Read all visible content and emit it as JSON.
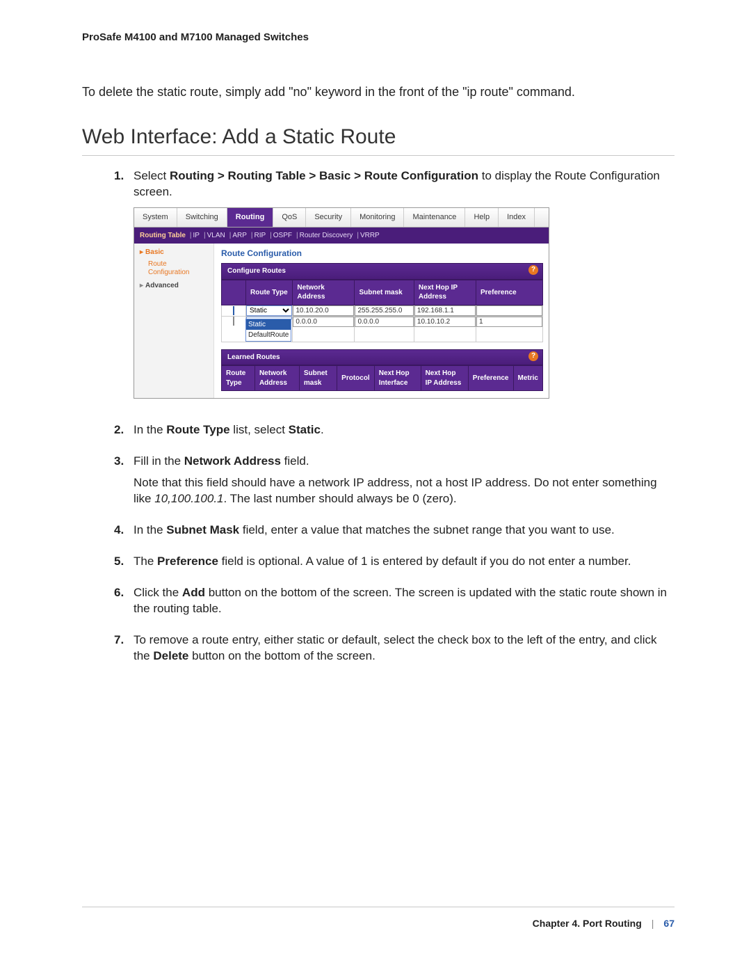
{
  "running_header": "ProSafe M4100 and M7100 Managed Switches",
  "intro": "To delete the static route, simply add \"no\" keyword in the front of the \"ip route\" command.",
  "heading": "Web Interface: Add a Static Route",
  "steps": [
    {
      "num": "1.",
      "html_parts": [
        {
          "t": "plain",
          "v": "Select "
        },
        {
          "t": "bold",
          "v": "Routing > Routing Table > Basic > Route Configuration"
        },
        {
          "t": "plain",
          "v": " to display the Route Configuration screen."
        }
      ]
    },
    {
      "num": "2.",
      "html_parts": [
        {
          "t": "plain",
          "v": "In the "
        },
        {
          "t": "bold",
          "v": "Route Type"
        },
        {
          "t": "plain",
          "v": " list, select "
        },
        {
          "t": "bold",
          "v": "Static"
        },
        {
          "t": "plain",
          "v": "."
        }
      ]
    },
    {
      "num": "3.",
      "html_parts": [
        {
          "t": "plain",
          "v": "Fill in the "
        },
        {
          "t": "bold",
          "v": "Network Address"
        },
        {
          "t": "plain",
          "v": " field."
        }
      ],
      "note_parts": [
        {
          "t": "plain",
          "v": "Note that this field should have a network IP address, not a host IP address. Do not enter something like "
        },
        {
          "t": "italic",
          "v": "10,100.100.1"
        },
        {
          "t": "plain",
          "v": ". The last number should always be 0 (zero)."
        }
      ]
    },
    {
      "num": "4.",
      "html_parts": [
        {
          "t": "plain",
          "v": "In the "
        },
        {
          "t": "bold",
          "v": "Subnet Mask"
        },
        {
          "t": "plain",
          "v": " field, enter a value that matches the subnet range that you want to use."
        }
      ]
    },
    {
      "num": "5.",
      "html_parts": [
        {
          "t": "plain",
          "v": "The "
        },
        {
          "t": "bold",
          "v": "Preference"
        },
        {
          "t": "plain",
          "v": " field is optional. A value of 1 is entered by default if you do not enter a number."
        }
      ]
    },
    {
      "num": "6.",
      "html_parts": [
        {
          "t": "plain",
          "v": "Click the "
        },
        {
          "t": "bold",
          "v": "Add"
        },
        {
          "t": "plain",
          "v": " button on the bottom of the screen. The screen is updated with the static route shown in the routing table."
        }
      ]
    },
    {
      "num": "7.",
      "html_parts": [
        {
          "t": "plain",
          "v": "To remove a route entry, either static or default, select the check box to the left of the entry, and click the "
        },
        {
          "t": "bold",
          "v": "Delete"
        },
        {
          "t": "plain",
          "v": " button on the bottom of the screen."
        }
      ]
    }
  ],
  "ui": {
    "top_tabs": [
      "System",
      "Switching",
      "Routing",
      "QoS",
      "Security",
      "Monitoring",
      "Maintenance",
      "Help",
      "Index"
    ],
    "active_top": "Routing",
    "sub_tabs": [
      "Routing Table",
      "IP",
      "VLAN",
      "ARP",
      "RIP",
      "OSPF",
      "Router Discovery",
      "VRRP"
    ],
    "active_sub": "Routing Table",
    "sidebar": {
      "section": "Basic",
      "sub_item": "Route Configuration",
      "other": "Advanced"
    },
    "panel_title": "Route Configuration",
    "configure_bar": "Configure Routes",
    "headers1": [
      "Route Type",
      "Network Address",
      "Subnet mask",
      "Next Hop IP Address",
      "Preference"
    ],
    "rows1": [
      {
        "checked": true,
        "type_select": "Static",
        "net": "10.10.20.0",
        "mask": "255.255.255.0",
        "hop": "192.168.1.1",
        "pref": ""
      },
      {
        "checked": false,
        "type_display": "Static",
        "dropdown_options": [
          "Static",
          "DefaultRoute"
        ],
        "net": "0.0.0.0",
        "mask": "0.0.0.0",
        "hop": "10.10.10.2",
        "pref": "1"
      }
    ],
    "learned_bar": "Learned Routes",
    "headers2": [
      "Route Type",
      "Network Address",
      "Subnet mask",
      "Protocol",
      "Next Hop Interface",
      "Next Hop IP Address",
      "Preference",
      "Metric"
    ]
  },
  "footer": {
    "chapter": "Chapter 4.  Port Routing",
    "sep": "|",
    "page": "67"
  }
}
